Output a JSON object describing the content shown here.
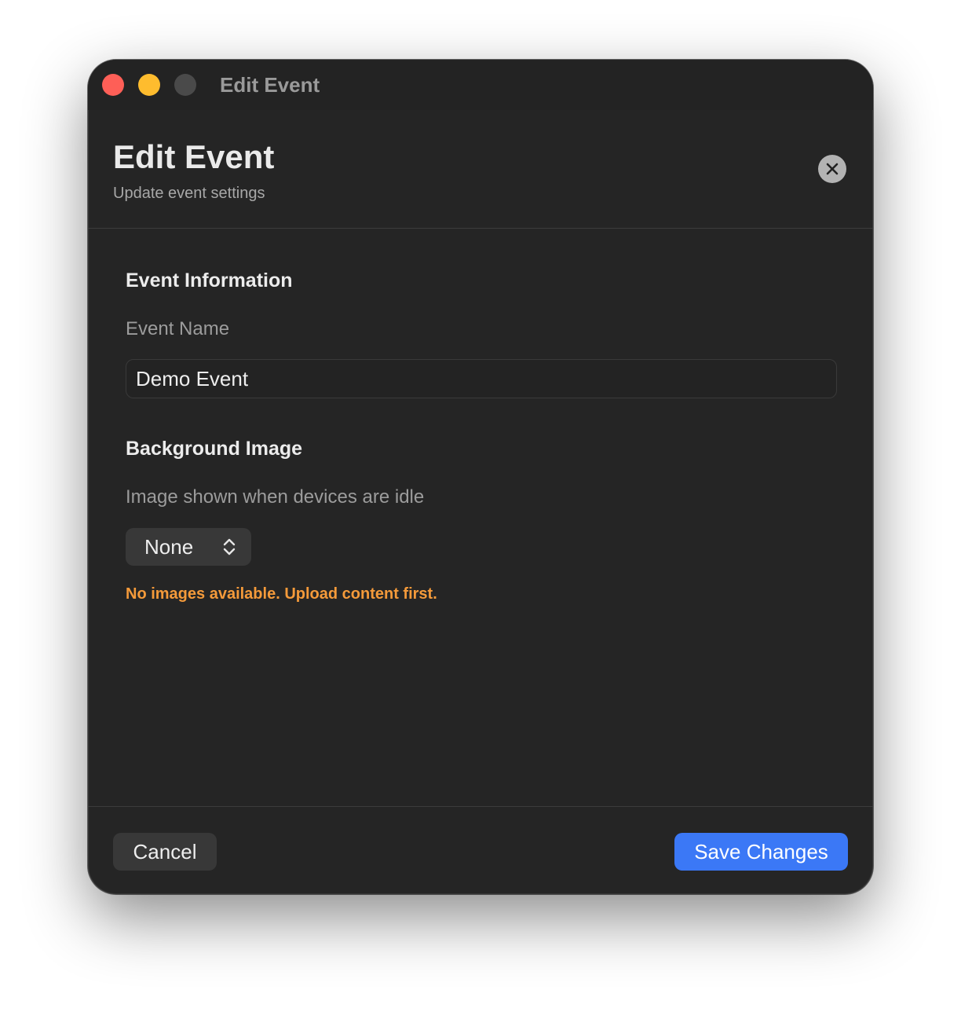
{
  "window": {
    "title": "Edit Event"
  },
  "header": {
    "title": "Edit Event",
    "subtitle": "Update event settings",
    "close_icon": "xmark-circle-icon"
  },
  "event_information": {
    "heading": "Event Information",
    "name_label": "Event Name",
    "name_value": "Demo Event"
  },
  "background_image": {
    "heading": "Background Image",
    "description": "Image shown when devices are idle",
    "selected": "None",
    "selector_icon": "chevron-up-down-icon",
    "warning": "No images available. Upload content first."
  },
  "footer": {
    "cancel_label": "Cancel",
    "save_label": "Save Changes"
  },
  "colors": {
    "window_bg": "#252525",
    "accent": "#3b78f6",
    "warning": "#f49a3a",
    "traffic_close": "#fe5f57",
    "traffic_minimize": "#febc2e",
    "traffic_zoom_inactive": "#4a4a4a"
  }
}
